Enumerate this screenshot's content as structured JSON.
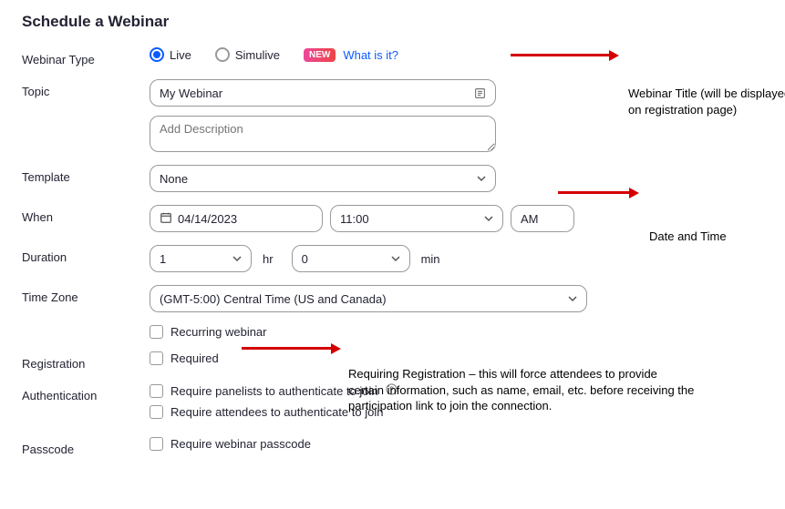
{
  "title": "Schedule a Webinar",
  "labels": {
    "webinar_type": "Webinar Type",
    "topic": "Topic",
    "template": "Template",
    "when": "When",
    "duration": "Duration",
    "time_zone": "Time Zone",
    "registration": "Registration",
    "authentication": "Authentication",
    "passcode": "Passcode"
  },
  "webinar_type": {
    "live": "Live",
    "simulive": "Simulive",
    "new_badge": "NEW",
    "what_is_it": "What is it?",
    "selected": "live"
  },
  "topic": {
    "value": "My Webinar",
    "description_placeholder": "Add Description"
  },
  "template": {
    "value": "None"
  },
  "when": {
    "date": "04/14/2023",
    "time": "11:00",
    "ampm": "AM"
  },
  "duration": {
    "hours": "1",
    "hours_suffix": "hr",
    "minutes": "0",
    "minutes_suffix": "min"
  },
  "time_zone": {
    "value": "(GMT-5:00) Central Time (US and Canada)"
  },
  "recurring": {
    "label": "Recurring webinar"
  },
  "registration": {
    "required_label": "Required"
  },
  "authentication": {
    "panelists": "Require panelists to authenticate to join",
    "attendees": "Require attendees to authenticate to join"
  },
  "passcode": {
    "label": "Require webinar passcode"
  },
  "annotations": {
    "title": "Webinar Title (will be displayed on registration page)",
    "datetime": "Date and Time",
    "registration": "Requiring Registration – this will force attendees to provide certain information, such as name, email, etc. before receiving the participation link to join the connection."
  },
  "colors": {
    "accent": "#0b5cff",
    "arrow": "#d40000"
  }
}
